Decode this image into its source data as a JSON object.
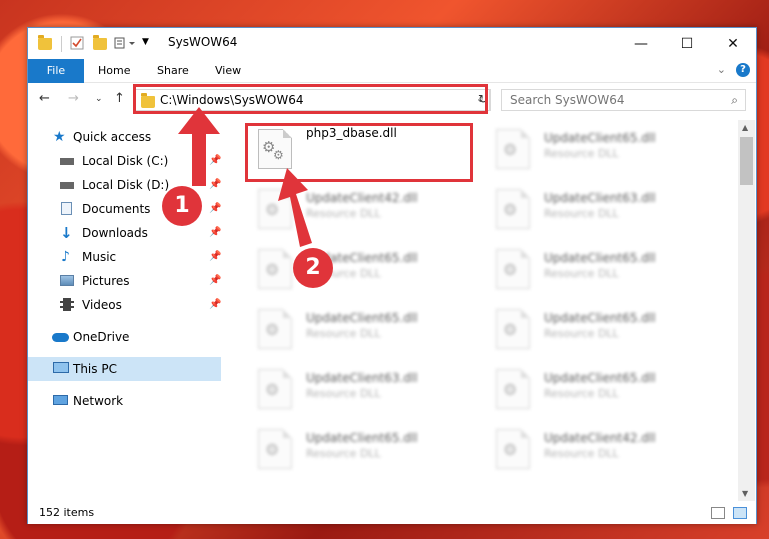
{
  "window": {
    "title": "SysWOW64",
    "controls": {
      "minimize": "—",
      "maximize": "☐",
      "close": "✕"
    }
  },
  "ribbon": {
    "tabs": [
      "File",
      "Home",
      "Share",
      "View"
    ]
  },
  "address": {
    "path": "C:\\Windows\\SysWOW64",
    "search_placeholder": "Search SysWOW64"
  },
  "sidebar": {
    "quick_access": "Quick access",
    "pinned": [
      "Local Disk (C:)",
      "Local Disk (D:)",
      "Documents",
      "Downloads",
      "Music",
      "Pictures",
      "Videos"
    ],
    "onedrive": "OneDrive",
    "this_pc": "This PC",
    "network": "Network"
  },
  "files": {
    "highlighted": {
      "name": "php3_dbase.dll"
    },
    "left_column": [
      {
        "name": "UpdateClient42.dll",
        "type": "Resource DLL"
      },
      {
        "name": "UpdateClient65.dll",
        "type": "Resource DLL"
      },
      {
        "name": "UpdateClient65.dll",
        "type": "Resource DLL"
      },
      {
        "name": "UpdateClient63.dll",
        "type": "Resource DLL"
      },
      {
        "name": "UpdateClient65.dll",
        "type": "Resource DLL"
      }
    ],
    "right_column": [
      {
        "name": "UpdateClient65.dll",
        "type": "Resource DLL"
      },
      {
        "name": "UpdateClient63.dll",
        "type": "Resource DLL"
      },
      {
        "name": "UpdateClient65.dll",
        "type": "Resource DLL"
      },
      {
        "name": "UpdateClient65.dll",
        "type": "Resource DLL"
      },
      {
        "name": "UpdateClient65.dll",
        "type": "Resource DLL"
      },
      {
        "name": "UpdateClient42.dll",
        "type": "Resource DLL"
      }
    ]
  },
  "status": {
    "item_count": "152 items"
  },
  "callouts": {
    "one": "1",
    "two": "2"
  },
  "colors": {
    "accent": "#1979ca",
    "callout": "#e0343a",
    "selected": "#cce4f7"
  }
}
